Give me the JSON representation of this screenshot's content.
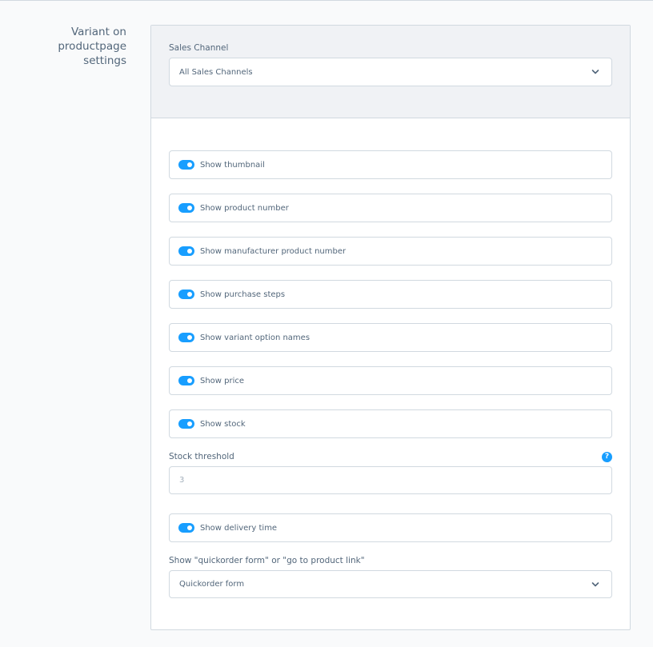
{
  "section": {
    "title_line1": "Variant on productpage",
    "title_line2": "settings"
  },
  "sales_channel": {
    "label": "Sales Channel",
    "value": "All Sales Channels"
  },
  "toggles": [
    {
      "label": "Show thumbnail",
      "on": true
    },
    {
      "label": "Show product number",
      "on": true
    },
    {
      "label": "Show manufacturer product number",
      "on": true
    },
    {
      "label": "Show purchase steps",
      "on": true
    },
    {
      "label": "Show variant option names",
      "on": true
    },
    {
      "label": "Show price",
      "on": true
    },
    {
      "label": "Show stock",
      "on": true
    }
  ],
  "stock_threshold": {
    "label": "Stock threshold",
    "placeholder": "3",
    "help_glyph": "?"
  },
  "delivery_toggle": {
    "label": "Show delivery time",
    "on": true
  },
  "link_mode": {
    "label": "Show \"quickorder form\" or \"go to product link\"",
    "value": "Quickorder form"
  },
  "colors": {
    "accent": "#189eff",
    "border": "#d1d9e0",
    "text": "#52667a",
    "header_bg": "#f0f2f5"
  },
  "icons": {
    "select_chevron": "chevron-down-icon",
    "help": "question-icon"
  }
}
